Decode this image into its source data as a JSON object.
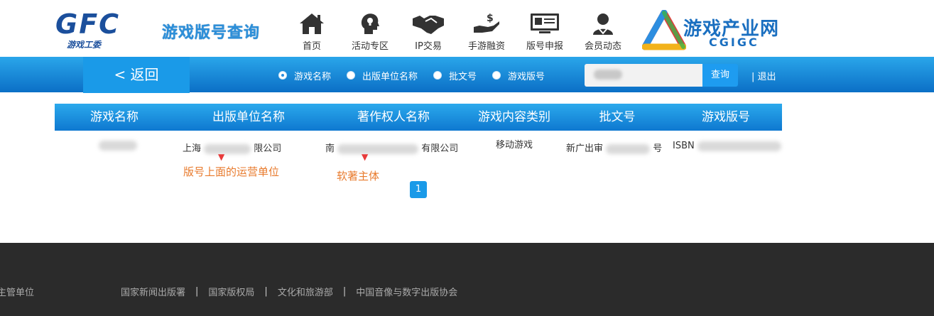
{
  "header": {
    "logo_text": "GFC",
    "logo_sub": "游戏工委",
    "page_heading": "游戏版号查询",
    "nav": [
      {
        "label": "首页",
        "icon": "home-icon"
      },
      {
        "label": "活动专区",
        "icon": "head-bulb-icon"
      },
      {
        "label": "IP交易",
        "icon": "handshake-icon"
      },
      {
        "label": "手游融资",
        "icon": "money-hand-icon"
      },
      {
        "label": "版号申报",
        "icon": "monitor-icon"
      },
      {
        "label": "会员动态",
        "icon": "user-icon"
      }
    ],
    "partner_logo_title": "游戏产业网",
    "partner_logo_sub": "CGIGC"
  },
  "search_bar": {
    "back_label": "< 返回",
    "options": [
      {
        "label": "游戏名称",
        "selected": true
      },
      {
        "label": "出版单位名称",
        "selected": false
      },
      {
        "label": "批文号",
        "selected": false
      },
      {
        "label": "游戏版号",
        "selected": false
      }
    ],
    "search_button": "查询",
    "logout": "| 退出"
  },
  "table": {
    "columns": [
      "游戏名称",
      "出版单位名称",
      "著作权人名称",
      "游戏内容类别",
      "批文号",
      "游戏版号"
    ],
    "rows": [
      {
        "publisher_prefix": "上海",
        "publisher_suffix": "限公司",
        "copyright_prefix": "南",
        "copyright_suffix": "有限公司",
        "category": "移动游戏",
        "approval_prefix": "新广出审",
        "approval_suffix": "号",
        "isbn_prefix": "ISBN"
      }
    ]
  },
  "annotations": {
    "publisher_note": "版号上面的运营单位",
    "copyright_note": "软著主体"
  },
  "pagination": {
    "current": "1"
  },
  "footer": {
    "label": "主管单位",
    "links": [
      "国家新闻出版署",
      "国家版权局",
      "文化和旅游部",
      "中国音像与数字出版协会"
    ]
  },
  "colors": {
    "brand_blue": "#1a9ae8",
    "note_orange": "#e87a2c",
    "footer_bg": "#2b2b2b"
  }
}
